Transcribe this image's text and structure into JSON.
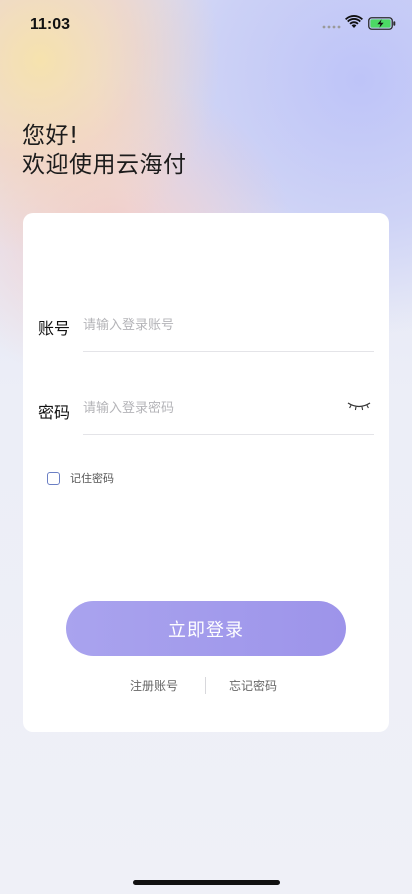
{
  "status_bar": {
    "time": "11:03"
  },
  "greeting": {
    "line1": "您好!",
    "line2": "欢迎使用云海付"
  },
  "form": {
    "account_label": "账号",
    "account_placeholder": "请输入登录账号",
    "password_label": "密码",
    "password_placeholder": "请输入登录密码",
    "remember_label": "记住密码",
    "remember_checked": false
  },
  "actions": {
    "login_label": "立即登录",
    "register_label": "注册账号",
    "forgot_label": "忘记密码"
  },
  "colors": {
    "accent": "#a29aec",
    "checkbox_border": "#6b7fc4"
  },
  "icons": {
    "password_toggle": "eye-closed-icon",
    "wifi": "wifi-icon",
    "battery": "battery-charging-icon"
  }
}
